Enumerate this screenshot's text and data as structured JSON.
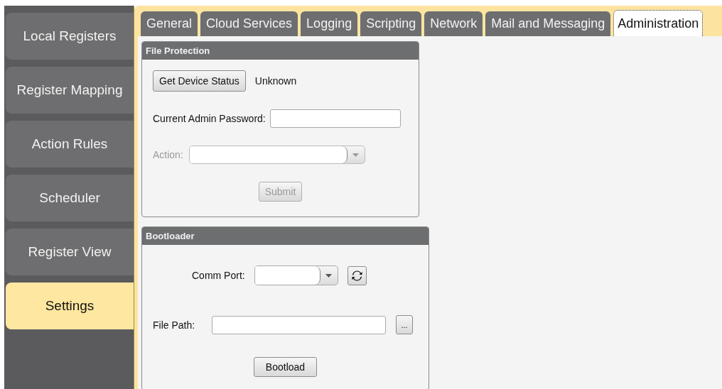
{
  "sidebar": {
    "items": [
      {
        "label": "Local Registers",
        "selected": false
      },
      {
        "label": "Register Mapping",
        "selected": false
      },
      {
        "label": "Action Rules",
        "selected": false
      },
      {
        "label": "Scheduler",
        "selected": false
      },
      {
        "label": "Register View",
        "selected": false
      },
      {
        "label": "Settings",
        "selected": true
      }
    ]
  },
  "tabs": [
    {
      "label": "General",
      "selected": false
    },
    {
      "label": "Cloud Services",
      "selected": false
    },
    {
      "label": "Logging",
      "selected": false
    },
    {
      "label": "Scripting",
      "selected": false
    },
    {
      "label": "Network",
      "selected": false
    },
    {
      "label": "Mail and Messaging",
      "selected": false
    },
    {
      "label": "Administration",
      "selected": true
    }
  ],
  "file_protection": {
    "title": "File Protection",
    "status_button": "Get Device Status",
    "status_value": "Unknown",
    "password_label": "Current Admin Password:",
    "action_label": "Action:",
    "action_disabled": true,
    "submit_label": "Submit",
    "submit_disabled": true
  },
  "bootloader": {
    "title": "Bootloader",
    "comm_port_label": "Comm Port:",
    "file_path_label": "File Path:",
    "browse_label": "...",
    "bootload_label": "Bootload"
  }
}
